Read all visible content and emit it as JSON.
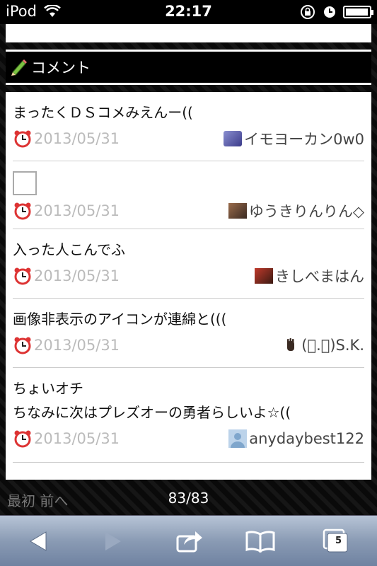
{
  "status_bar": {
    "carrier": "iPod",
    "time": "22:17"
  },
  "section": {
    "title": "コメント",
    "icon": "pencil-icon"
  },
  "comments": [
    {
      "lines": [
        "まったくＤＳコメみえんー(("
      ],
      "date": "2013/05/31",
      "user": "イモヨーカン0w0"
    },
    {
      "lines": [],
      "date": "2013/05/31",
      "user": "ゆうきりんりん◇",
      "broken_image": true
    },
    {
      "lines": [
        "入った人こんでふ"
      ],
      "date": "2013/05/31",
      "user": "きしべまはん"
    },
    {
      "lines": [
        "画像非表示のアイコンが連綿と((("
      ],
      "date": "2013/05/31",
      "user": "(ﾟ.ﾟ)S.K."
    },
    {
      "lines": [
        "ちょいオチ",
        "ちなみに次はプレズオーの勇者らしいよ☆(("
      ],
      "date": "2013/05/31",
      "user": "anydaybest122"
    }
  ],
  "pager": {
    "first": "最初",
    "prev": "前へ",
    "count": "83/83"
  },
  "toolbar": {
    "tabs_count": "5"
  },
  "colors": {
    "toolbar_top": "#b7c4d6",
    "toolbar_bottom": "#6f82a1",
    "date_text": "#bbbbbb"
  }
}
